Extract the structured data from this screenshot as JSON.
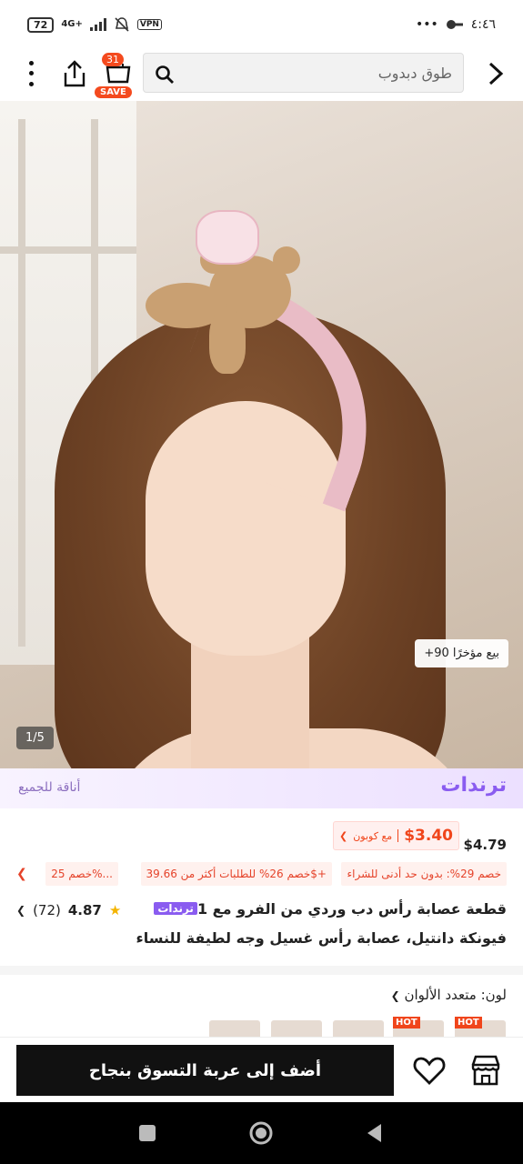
{
  "status": {
    "time": "٤:٤٦",
    "battery": "72",
    "network": "4G+",
    "vpn": "VPN",
    "more": "•••"
  },
  "topbar": {
    "search_placeholder": "طوق دبدوب",
    "cart_count": "31",
    "save_label": "SAVE"
  },
  "hero": {
    "sold_text": "+90 بيع مؤخرًا",
    "image_counter": "1/5"
  },
  "trend": {
    "label": "ترندات",
    "slogan": "أناقة للجميع"
  },
  "price": {
    "original": "$4.79",
    "coupon_price": "$3.40",
    "coupon_label": "مع كوبون"
  },
  "discounts": [
    "خصم 29%: بدون حد أدنى للشراء",
    "خصم 26% للطلبات أكثر من 39.66$+",
    "خصم 25%..."
  ],
  "product": {
    "tag": "ترندات",
    "title_line1": "1 قطعة عصابة رأس دب وردي من الفرو مع",
    "title_line2": "فيونكة دانتيل، عصابة رأس غسيل وجه لطيفة للنساء",
    "rating": "4.87",
    "reviews": "(72)"
  },
  "color": {
    "label": "لون: متعدد الألوان",
    "hot_label": "HOT"
  },
  "bottom": {
    "add_to_cart": "أضف إلى عربة التسوق بنجاح"
  },
  "colors": {
    "accent": "#f0451b",
    "trend": "#8a5cf0"
  }
}
